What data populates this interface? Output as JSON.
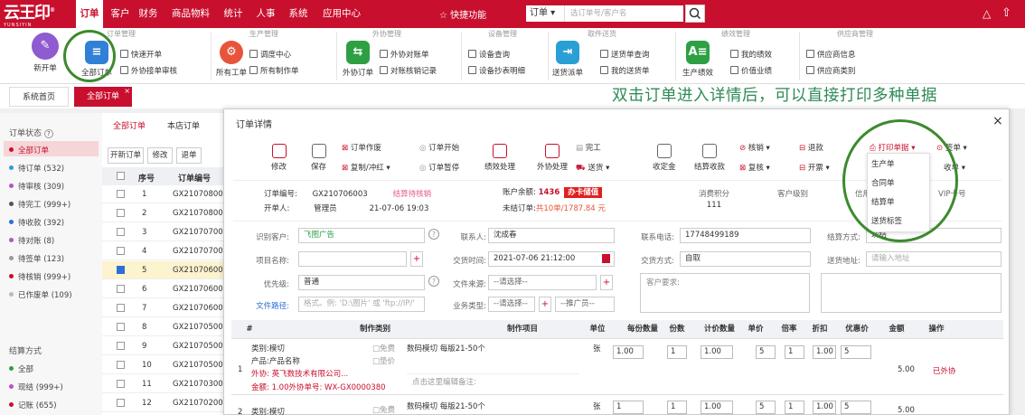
{
  "logo": {
    "text": "云王印",
    "sub": "YUNSIYIN",
    "reg": "®"
  },
  "nav": [
    {
      "label": "订单",
      "active": true
    },
    {
      "label": "客户"
    },
    {
      "label": "财务"
    },
    {
      "label": "商品物料"
    },
    {
      "label": "统计"
    },
    {
      "label": "人事"
    },
    {
      "label": "系统"
    },
    {
      "label": "应用中心"
    }
  ],
  "header": {
    "quick": "☆ 快捷功能",
    "order_select": "订单 ▾",
    "search_placeholder": "选订单号/客户名"
  },
  "ribbon": {
    "groups": [
      "订单管理",
      "生产管理",
      "外协管理",
      "设备管理",
      "取件送货",
      "绩效管理",
      "供应商管理"
    ],
    "new_order": "新开单",
    "all_orders": "全部订单",
    "quick_order": "快速开单",
    "outsource_review": "外协接单审核",
    "all_work": "所有工单",
    "schedule": "调度中心",
    "all_make": "所有制作单",
    "outsource_order": "外协订单",
    "outsource_account": "外协对账单",
    "reconcile": "对账核销记录",
    "device_query": "设备查询",
    "device_meter": "设备抄表明细",
    "delivery_dispatch": "送货派单",
    "delivery_query": "送货单查询",
    "my_delivery": "我的送货单",
    "prod_perf": "生产绩效",
    "my_perf": "我的绩效",
    "value_perf": "价值业绩",
    "supplier_info": "供应商信息",
    "supplier_class": "供应商类别"
  },
  "page_tabs": {
    "home": "系统首页",
    "all_orders": "全部订单",
    "close": "×"
  },
  "annotation": "双击订单进入详情后，可以直接打印多种单据",
  "left": {
    "status_title": "订单状态",
    "help": "?",
    "statuses": [
      {
        "label": "全部订单",
        "color": "#c8102e"
      },
      {
        "label": "待订单 (532)",
        "color": "#2a9fd6"
      },
      {
        "label": "待审核 (309)",
        "color": "#b455c9"
      },
      {
        "label": "待完工 (999+)",
        "color": "#555555"
      },
      {
        "label": "待收款 (392)",
        "color": "#2a6fd6"
      },
      {
        "label": "待对账 (8)",
        "color": "#b455c9"
      },
      {
        "label": "待签单 (123)",
        "color": "#999999"
      },
      {
        "label": "待核销 (999+)",
        "color": "#c8102e"
      },
      {
        "label": "已作废单 (109)",
        "color": "#bbbbbb"
      }
    ],
    "settle_title": "结算方式",
    "settles": [
      {
        "label": "全部",
        "color": "#2ea043"
      },
      {
        "label": "现结 (999+)",
        "color": "#b455c9"
      },
      {
        "label": "记账 (655)",
        "color": "#c8102e"
      }
    ]
  },
  "list": {
    "tab_all": "全部订单",
    "tab_store": "本店订单",
    "btn_new": "开新订单",
    "btn_edit": "修改",
    "btn_back": "退单",
    "col_no": "序号",
    "col_order": "订单编号",
    "rows": [
      {
        "n": "1",
        "id": "GX21070800"
      },
      {
        "n": "2",
        "id": "GX21070800"
      },
      {
        "n": "3",
        "id": "GX21070700"
      },
      {
        "n": "4",
        "id": "GX21070700"
      },
      {
        "n": "5",
        "id": "GX21070600"
      },
      {
        "n": "6",
        "id": "GX21070600"
      },
      {
        "n": "7",
        "id": "GX21070600"
      },
      {
        "n": "8",
        "id": "GX21070500"
      },
      {
        "n": "9",
        "id": "GX21070500"
      },
      {
        "n": "10",
        "id": "GX21070500"
      },
      {
        "n": "11",
        "id": "GX21070300"
      },
      {
        "n": "12",
        "id": "GX21070200"
      }
    ]
  },
  "modal": {
    "title": "订单详情",
    "close": "×",
    "toolbar": {
      "edit": "修改",
      "save": "保存",
      "void": "订单作废",
      "copy": "复制/冲红 ▾",
      "start": "订单开始",
      "pause": "订单暂停",
      "perf": "绩效处理",
      "outsource": "外协处理",
      "delivery": "送货 ▾",
      "finish": "完工",
      "pay_order": "收定金",
      "settle": "结算收款",
      "verify": "核销 ▾",
      "recheck": "复核 ▾",
      "refund": "退款",
      "invoice": "开票 ▾",
      "print": "打印单据 ▾",
      "sign": "签单 ▾",
      "collect": "收单 ▾",
      "print_menu": [
        "生产单",
        "合同单",
        "结算单",
        "送货标签"
      ]
    },
    "summary": {
      "order_no_label": "订单编号:",
      "order_no": "GX210706003",
      "status": "结算待核销",
      "opener_label": "开单人:",
      "opener": "管理员",
      "open_time": "21-07-06 19:03",
      "balance_label": "账户余额:",
      "balance": "1436",
      "card_btn": "办卡储值",
      "unsettled_label": "未结订单:",
      "unsettled": "共10单/1787.84 元",
      "points_label": "消费积分",
      "points": "111",
      "level_label": "客户级别",
      "credit_label": "信用",
      "vip_label": "VIP卡号"
    },
    "form": {
      "customer_label": "识别客户:",
      "customer": "飞图广告",
      "contact_label": "联系人:",
      "contact": "沈成春",
      "phone_label": "联系电话:",
      "phone": "17748499189",
      "settle_label": "结算方式:",
      "settle": "现结",
      "project_label": "项目名称:",
      "trade_time_label": "交货时间:",
      "trade_time": "2021-07-06 21:12:00",
      "trade_mode_label": "交货方式:",
      "trade_mode": "自取",
      "address_label": "送货地址:",
      "address_ph": "请输入地址",
      "priority_label": "优先级:",
      "priority": "普通",
      "source_label": "文件来源:",
      "source": "--请选择--",
      "req_label": "客户要求:",
      "path_label": "文件路径:",
      "path_ph": "格式。例: 'D:\\图片' 或 'ftp://IP/'",
      "biz_label": "业务类型:",
      "biz": "--请选择--",
      "promoter": "--推广员--"
    },
    "table": {
      "headers": [
        "#",
        "制作类别",
        "制作项目",
        "单位",
        "每份数量",
        "份数",
        "计价数量",
        "单价",
        "倍率",
        "折扣",
        "优惠价",
        "金额",
        "操作"
      ],
      "rows": [
        {
          "n": "1",
          "cat": "类别:模切",
          "prod": "产品:产品名称",
          "out": "外协: 英飞数技术有限公司...",
          "amt": "金额: 1.00外协单号: WX-GX0000380",
          "free": "□免费",
          "adv": "□垫价",
          "item": "数码模切 每版21-50个",
          "remark": "点击这里编辑备注:",
          "unit": "张",
          "qty": "1.00",
          "copies": "1",
          "calc": "1.00",
          "price": "5",
          "rate": "1",
          "disc": "1.00",
          "promo": "5",
          "total": "5.00",
          "op": "已外协"
        },
        {
          "n": "2",
          "cat": "类别:模切",
          "free": "□免费",
          "item": "数码模切 每版21-50个",
          "unit": "张",
          "qty": "1",
          "copies": "1",
          "calc": "1.00",
          "price": "5",
          "rate": "1",
          "disc": "1.00",
          "promo": "5",
          "total": "5.00"
        }
      ]
    }
  }
}
